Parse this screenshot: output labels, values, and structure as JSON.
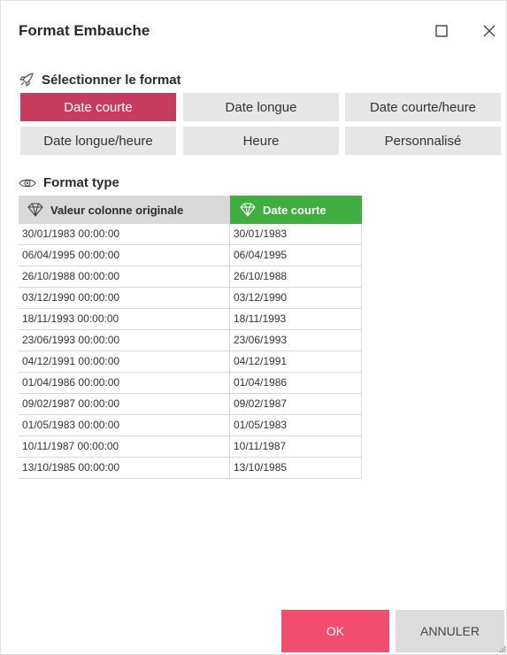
{
  "dialog": {
    "title": "Format Embauche",
    "maximize_icon": "square-icon",
    "close_icon": "x-icon"
  },
  "select_section": {
    "label": "Sélectionner le format",
    "icon": "rocket-icon"
  },
  "formats": [
    {
      "label": "Date courte",
      "active": true
    },
    {
      "label": "Date longue",
      "active": false
    },
    {
      "label": "Date courte/heure",
      "active": false
    },
    {
      "label": "Date longue/heure",
      "active": false
    },
    {
      "label": "Heure",
      "active": false
    },
    {
      "label": "Personnalisé",
      "active": false
    }
  ],
  "format_section": {
    "label": "Format type",
    "icon": "eye-icon"
  },
  "grid": {
    "columns": [
      "Valeur colonne originale",
      "Date courte"
    ],
    "rows": [
      [
        "30/01/1983 00:00:00",
        "30/01/1983"
      ],
      [
        "06/04/1995 00:00:00",
        "06/04/1995"
      ],
      [
        "26/10/1988 00:00:00",
        "26/10/1988"
      ],
      [
        "03/12/1990 00:00:00",
        "03/12/1990"
      ],
      [
        "18/11/1993 00:00:00",
        "18/11/1993"
      ],
      [
        "23/06/1993 00:00:00",
        "23/06/1993"
      ],
      [
        "04/12/1991 00:00:00",
        "04/12/1991"
      ],
      [
        "01/04/1986 00:00:00",
        "01/04/1986"
      ],
      [
        "09/02/1987 00:00:00",
        "09/02/1987"
      ],
      [
        "01/05/1983 00:00:00",
        "01/05/1983"
      ],
      [
        "10/11/1987 00:00:00",
        "10/11/1987"
      ],
      [
        "13/10/1985 00:00:00",
        "13/10/1985"
      ]
    ]
  },
  "footer": {
    "ok_label": "OK",
    "cancel_label": "ANNULER"
  },
  "colors": {
    "active_format": "#c63c5f",
    "ok_button": "#f14d6e",
    "new_column_header": "#3fae3f"
  }
}
